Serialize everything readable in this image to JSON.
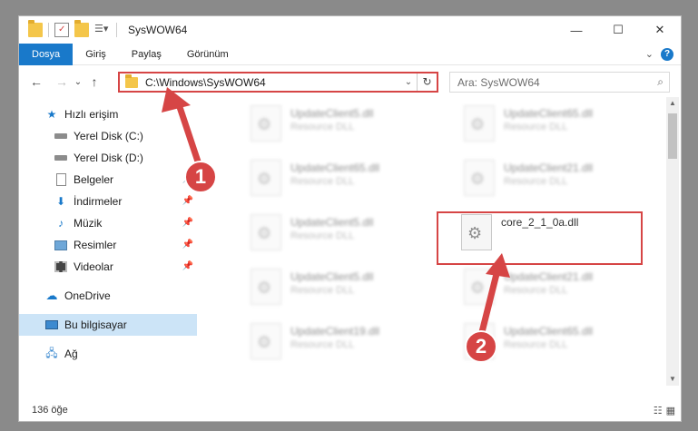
{
  "window": {
    "title": "SysWOW64",
    "minimize": "—",
    "maximize": "☐",
    "close": "✕"
  },
  "ribbon": {
    "tabs": [
      "Dosya",
      "Giriş",
      "Paylaş",
      "Görünüm"
    ],
    "expand": "⌄",
    "help": "?"
  },
  "nav": {
    "back": "←",
    "forward": "→",
    "recent": "⌄",
    "up": "↑",
    "address": "C:\\Windows\\SysWOW64",
    "address_dropdown": "⌄",
    "refresh": "↻",
    "search_placeholder": "Ara: SysWOW64",
    "search_icon": "⌕"
  },
  "sidebar": {
    "quick_access": "Hızlı erişim",
    "items": [
      {
        "label": "Yerel Disk (C:)",
        "icon": "drive-icon",
        "pinned": false
      },
      {
        "label": "Yerel Disk (D:)",
        "icon": "drive-icon",
        "pinned": false
      },
      {
        "label": "Belgeler",
        "icon": "documents-icon",
        "pinned": true
      },
      {
        "label": "İndirmeler",
        "icon": "downloads-icon",
        "pinned": true
      },
      {
        "label": "Müzik",
        "icon": "music-icon",
        "pinned": true
      },
      {
        "label": "Resimler",
        "icon": "pictures-icon",
        "pinned": true
      },
      {
        "label": "Videolar",
        "icon": "videos-icon",
        "pinned": true
      }
    ],
    "onedrive": "OneDrive",
    "this_pc": "Bu bilgisayar",
    "network": "Ağ"
  },
  "files": [
    {
      "name": "UpdateClient5.dll",
      "type": "Resource DLL",
      "blurred": true
    },
    {
      "name": "UpdateClient65.dll",
      "type": "Resource DLL",
      "blurred": true
    },
    {
      "name": "UpdateClient65.dll",
      "type": "Resource DLL",
      "blurred": true
    },
    {
      "name": "UpdateClient21.dll",
      "type": "Resource DLL",
      "blurred": true
    },
    {
      "name": "UpdateClient5.dll",
      "type": "Resource DLL",
      "blurred": true
    },
    {
      "name": "core_2_1_0a.dll",
      "type": "",
      "blurred": false
    },
    {
      "name": "UpdateClient5.dll",
      "type": "Resource DLL",
      "blurred": true
    },
    {
      "name": "UpdateClient21.dll",
      "type": "Resource DLL",
      "blurred": true
    },
    {
      "name": "UpdateClient19.dll",
      "type": "Resource DLL",
      "blurred": true
    },
    {
      "name": "UpdateClient65.dll",
      "type": "Resource DLL",
      "blurred": true
    }
  ],
  "status": {
    "count": "136 öğe"
  },
  "annotations": {
    "badge1": "1",
    "badge2": "2",
    "color": "#d64545"
  }
}
